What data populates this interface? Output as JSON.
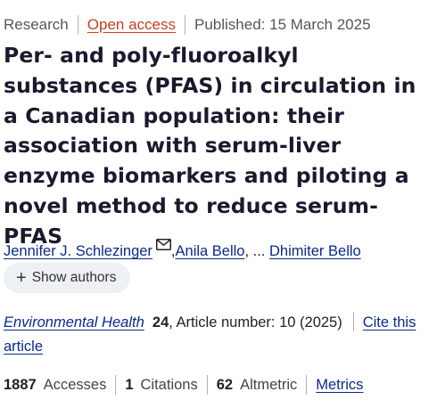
{
  "meta": {
    "article_type": "Research",
    "open_access": "Open access",
    "published": "Published: 15 March 2025"
  },
  "title": "Per- and poly-fluoroalkyl substances (PFAS) in circulation in a Canadian population: their association with serum-liver enzyme biomarkers and piloting a novel method to reduce serum-PFAS",
  "authors": {
    "first": "Jennifer J. Schlezinger",
    "second": "Anila Bello",
    "ellipsis": ", ... ",
    "last": "Dhimiter Bello",
    "comma": ", ",
    "show_label": "Show authors",
    "mail_icon": "mail-icon"
  },
  "journal": {
    "name": "Environmental Health",
    "volume": "24",
    "article_number": ", Article number: 10 (2025)",
    "cite": "Cite this article"
  },
  "metrics": {
    "accesses_count": "1887",
    "accesses_label": "Accesses",
    "citations_count": "1",
    "citations_label": "Citations",
    "altmetric_count": "62",
    "altmetric_label": "Altmetric",
    "metrics_link": "Metrics"
  },
  "colors": {
    "link": "#0a2a8a",
    "open_access": "#c7401c",
    "title": "#1a1a2e"
  }
}
